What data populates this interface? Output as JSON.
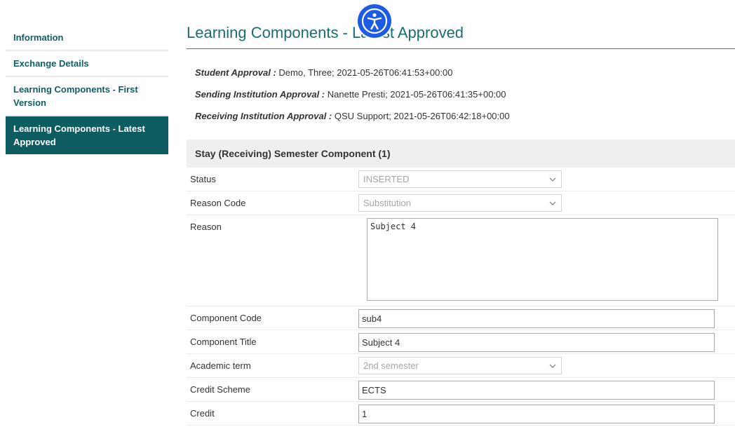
{
  "sidebar": {
    "items": [
      {
        "label": "Information"
      },
      {
        "label": "Exchange Details"
      },
      {
        "label": "Learning Components - First Version"
      },
      {
        "label": "Learning Components - Latest Approved"
      }
    ]
  },
  "page": {
    "title": "Learning Components - Latest Approved"
  },
  "approvals": [
    {
      "label": "Student Approval :",
      "value": "Demo, Three; 2021-05-26T06:41:53+00:00"
    },
    {
      "label": "Sending Institution Approval :",
      "value": "Nanette Presti; 2021-05-26T06:41:35+00:00"
    },
    {
      "label": "Receiving Institution Approval :",
      "value": "QSU Support; 2021-05-26T06:42:18+00:00"
    }
  ],
  "component": {
    "heading": "Stay (Receiving) Semester Component (1)",
    "status": {
      "label": "Status",
      "value": "INSERTED"
    },
    "reason_code": {
      "label": "Reason Code",
      "value": "Substitution"
    },
    "reason": {
      "label": "Reason",
      "value": "Subject 4"
    },
    "component_code": {
      "label": "Component Code",
      "value": "sub4"
    },
    "component_title": {
      "label": "Component Title",
      "value": "Subject 4"
    },
    "academic_term": {
      "label": "Academic term",
      "value": "2nd semester"
    },
    "credit_scheme": {
      "label": "Credit Scheme",
      "value": "ECTS"
    },
    "credit": {
      "label": "Credit",
      "value": "1"
    }
  },
  "icons": {
    "accessibility": "accessibility-icon",
    "dropdown": "chevron-down-icon"
  },
  "colors": {
    "accent": "#0d5c62",
    "title": "#1a6d70",
    "accessibility_button": "#1e5be4"
  }
}
